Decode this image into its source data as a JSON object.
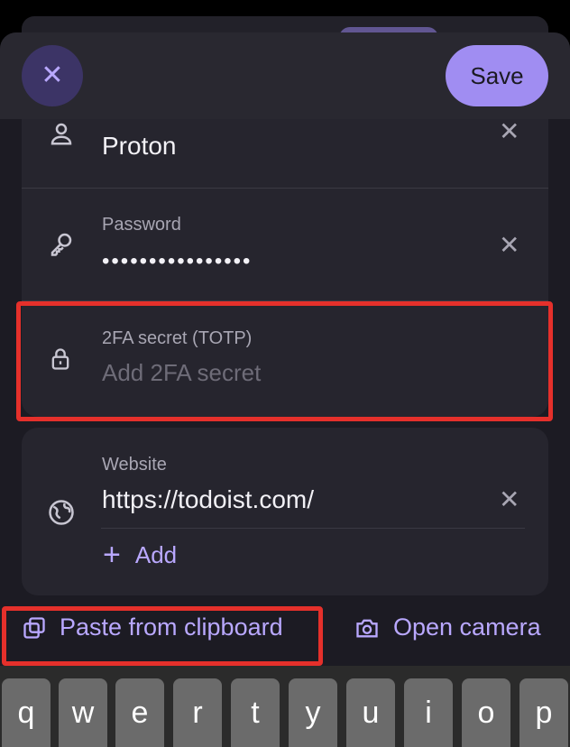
{
  "header": {
    "close_icon": "close-icon",
    "save_label": "Save"
  },
  "fields": {
    "username": {
      "value": "Proton",
      "icon": "person-icon"
    },
    "password": {
      "label": "Password",
      "value": "••••••••••••••••",
      "icon": "key-icon"
    },
    "totp": {
      "label": "2FA secret (TOTP)",
      "placeholder": "Add 2FA secret",
      "icon": "lock-icon"
    },
    "website": {
      "label": "Website",
      "value": "https://todoist.com/",
      "icon": "globe-icon",
      "add_label": "Add"
    }
  },
  "toolbar": {
    "paste_label": "Paste from clipboard",
    "camera_label": "Open camera"
  },
  "keyboard": {
    "keys": [
      "q",
      "w",
      "e",
      "r",
      "t",
      "y",
      "u",
      "i",
      "o",
      "p"
    ]
  },
  "colors": {
    "accent": "#a08df2",
    "highlight": "#e5302b",
    "background": "#1c1b23",
    "card": "#26252e"
  }
}
